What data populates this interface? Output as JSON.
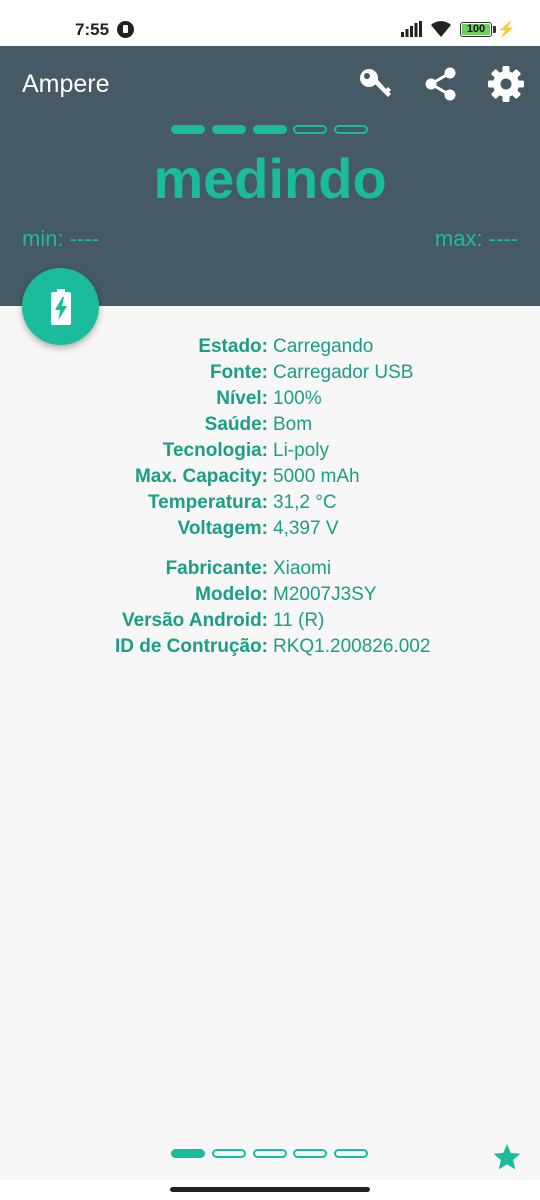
{
  "status_bar": {
    "time": "7:55",
    "battery_level": "100",
    "icons": [
      "app-notification-icon",
      "signal-icon",
      "wifi-icon",
      "battery-icon",
      "charging-bolt-icon"
    ]
  },
  "app": {
    "title": "Ampere",
    "actions": [
      "key-icon",
      "share-icon",
      "gear-icon"
    ]
  },
  "measurement": {
    "status": "medindo",
    "min": "min: ----",
    "max": "max: ----",
    "progress_steps_filled": 3,
    "progress_steps_total": 5
  },
  "colors": {
    "accent": "#1bbc9b",
    "header": "#455a64",
    "text_accent": "#1a9e86"
  },
  "battery_info": [
    {
      "label": "Estado:",
      "value": "Carregando"
    },
    {
      "label": "Fonte:",
      "value": "Carregador USB"
    },
    {
      "label": "Nível:",
      "value": "100%"
    },
    {
      "label": "Saúde:",
      "value": "Bom"
    },
    {
      "label": "Tecnologia:",
      "value": "Li-poly"
    },
    {
      "label": "Max. Capacity:",
      "value": "5000 mAh"
    },
    {
      "label": "Temperatura:",
      "value": "31,2 °C"
    },
    {
      "label": "Voltagem:",
      "value": "4,397 V"
    }
  ],
  "device_info": [
    {
      "label": "Fabricante:",
      "value": "Xiaomi"
    },
    {
      "label": "Modelo:",
      "value": "M2007J3SY"
    },
    {
      "label": "Versão Android:",
      "value": "11 (R)"
    },
    {
      "label": "ID de Contrução:",
      "value": "RKQ1.200826.002"
    }
  ],
  "pager": {
    "current_page": 1,
    "total_pages": 5
  }
}
